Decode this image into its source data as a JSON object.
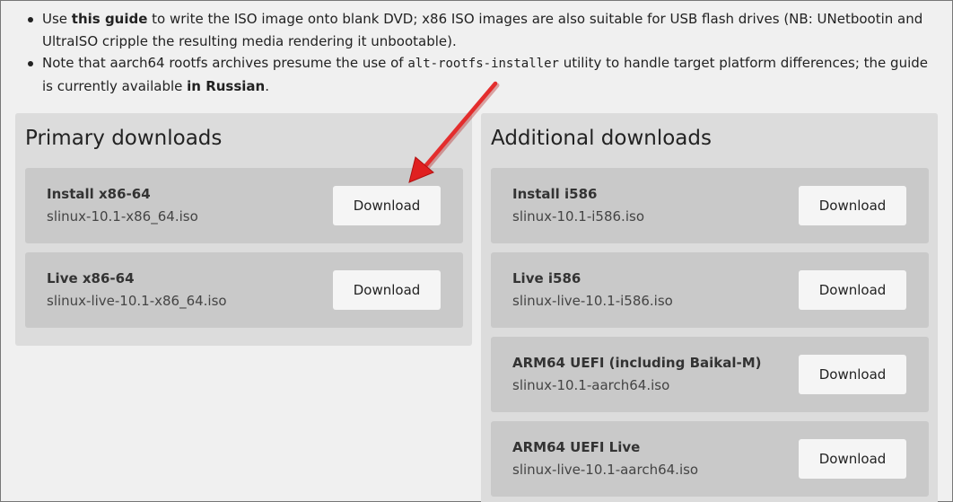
{
  "notes": {
    "line1": {
      "prefix": "Use ",
      "link": "this guide",
      "suffix": " to write the ISO image onto blank DVD; x86 ISO images are also suitable for USB flash drives (NB: UNetbootin and UltraISO cripple the resulting media rendering it unbootable)."
    },
    "line2": {
      "prefix": "Note that aarch64 rootfs archives presume the use of ",
      "code": "alt-rootfs-installer",
      "middle": " utility to handle target platform differences; the guide is currently available ",
      "link": "in Russian",
      "suffix": "."
    }
  },
  "primary": {
    "heading": "Primary downloads",
    "items": [
      {
        "title": "Install x86-64",
        "file": "slinux-10.1-x86_64.iso",
        "button": "Download"
      },
      {
        "title": "Live x86-64",
        "file": "slinux-live-10.1-x86_64.iso",
        "button": "Download"
      }
    ]
  },
  "additional": {
    "heading": "Additional downloads",
    "items": [
      {
        "title": "Install i586",
        "file": "slinux-10.1-i586.iso",
        "button": "Download"
      },
      {
        "title": "Live i586",
        "file": "slinux-live-10.1-i586.iso",
        "button": "Download"
      },
      {
        "title": "ARM64 UEFI (including Baikal-M)",
        "file": "slinux-10.1-aarch64.iso",
        "button": "Download"
      },
      {
        "title": "ARM64 UEFI Live",
        "file": "slinux-live-10.1-aarch64.iso",
        "button": "Download"
      }
    ]
  },
  "colors": {
    "arrow": "#e02020",
    "panel": "#dcdcdc",
    "item": "#c9c9c9",
    "button": "#f5f5f5"
  }
}
